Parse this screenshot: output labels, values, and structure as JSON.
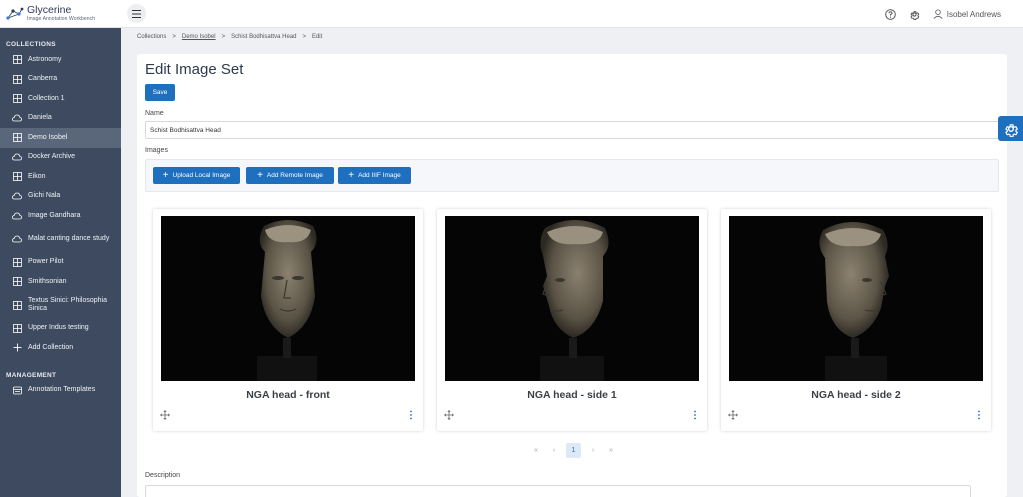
{
  "app": {
    "title": "Glycerine",
    "subtitle": "Image Annotation Workbench"
  },
  "header": {
    "user_name": "Isobel Andrews",
    "icons": [
      "menu-icon",
      "help-icon",
      "gear-icon",
      "user-icon"
    ]
  },
  "sidebar": {
    "collections_title": "COLLECTIONS",
    "items": [
      {
        "label": "Astronomy",
        "icon": "grid-icon"
      },
      {
        "label": "Canberra",
        "icon": "grid-icon"
      },
      {
        "label": "Collection 1",
        "icon": "grid-icon"
      },
      {
        "label": "Daniela",
        "icon": "cloud-icon"
      },
      {
        "label": "Demo Isobel",
        "icon": "grid-icon",
        "active": true
      },
      {
        "label": "Docker Archive",
        "icon": "cloud-icon"
      },
      {
        "label": "Eikon",
        "icon": "grid-icon"
      },
      {
        "label": "Gichi Nala",
        "icon": "cloud-icon"
      },
      {
        "label": "Image Gandhara",
        "icon": "cloud-icon"
      },
      {
        "label": "Malat canting dance study",
        "icon": "cloud-icon"
      },
      {
        "label": "Power Pilot",
        "icon": "grid-icon"
      },
      {
        "label": "Smithsonian",
        "icon": "grid-icon"
      },
      {
        "label": "Textus Sinici: Philosophia Sinica",
        "icon": "grid-icon"
      },
      {
        "label": "Upper Indus testing",
        "icon": "grid-icon"
      },
      {
        "label": "Add Collection",
        "icon": "plus-icon"
      }
    ],
    "management_title": "MANAGEMENT",
    "management_items": [
      {
        "label": "Annotation Templates",
        "icon": "template-icon"
      }
    ]
  },
  "breadcrumb": {
    "items": [
      "Collections",
      "Demo Isobel",
      "Schist Bodhisattva Head",
      "Edit"
    ],
    "separator": ">"
  },
  "main": {
    "title": "Edit Image Set",
    "save_label": "Save",
    "name_label": "Name",
    "name_value": "Schist Bodhisattva Head",
    "images_label": "Images",
    "upload_label": "Upload Local Image",
    "add_remote_label": "Add Remote Image",
    "add_iiif_label": "Add IIIF Image",
    "images": [
      {
        "caption": "NGA head - front"
      },
      {
        "caption": "NGA head - side 1"
      },
      {
        "caption": "NGA head - side 2"
      }
    ],
    "pagination": {
      "first": "«",
      "prev": "‹",
      "current": "1",
      "next": "›",
      "last": "»"
    },
    "description_label": "Description"
  },
  "colors": {
    "primary": "#1f6fbf",
    "sidebar_bg": "#3d4a5f",
    "sidebar_active": "#5a6679",
    "page_bg": "#eef0f4"
  }
}
